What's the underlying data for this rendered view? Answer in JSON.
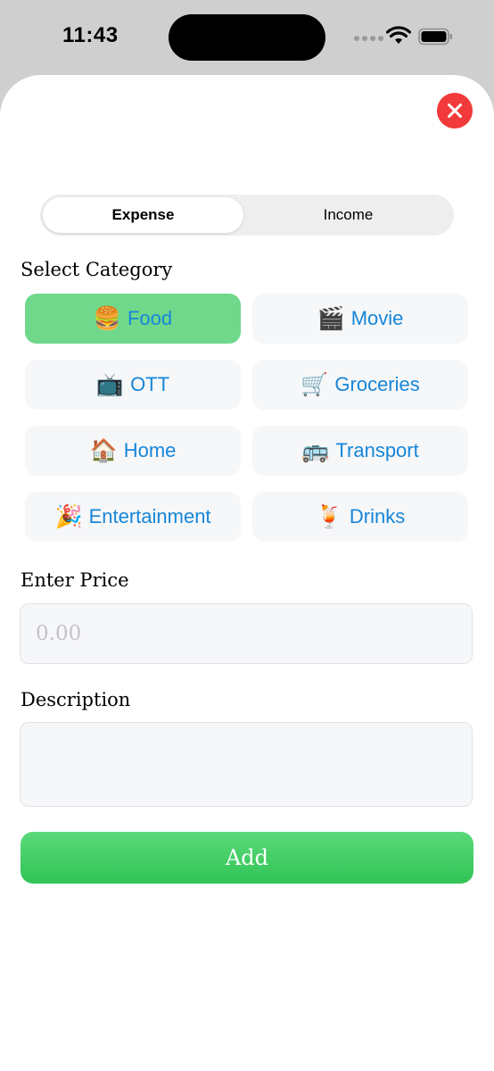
{
  "status_bar": {
    "time": "11:43"
  },
  "header": {
    "close_icon": "xmark-circle-icon",
    "close_color": "#f23a3a"
  },
  "type_toggle": {
    "options": [
      "Expense",
      "Income"
    ],
    "selected": "Expense"
  },
  "category": {
    "label": "Select Category",
    "selected": "Food",
    "accent_color": "#6fd88a",
    "text_color": "#1686d9",
    "items": [
      {
        "emoji": "🍔",
        "label": "Food"
      },
      {
        "emoji": "🎬",
        "label": "Movie"
      },
      {
        "emoji": "📺",
        "label": "OTT"
      },
      {
        "emoji": "🛒",
        "label": "Groceries"
      },
      {
        "emoji": "🏠",
        "label": "Home"
      },
      {
        "emoji": "🚌",
        "label": "Transport"
      },
      {
        "emoji": "🎉",
        "label": "Entertainment"
      },
      {
        "emoji": "🍹",
        "label": "Drinks"
      }
    ]
  },
  "price": {
    "label": "Enter Price",
    "placeholder": "0.00",
    "value": ""
  },
  "description": {
    "label": "Description",
    "value": ""
  },
  "add_button": {
    "label": "Add",
    "color": "#34c759"
  }
}
